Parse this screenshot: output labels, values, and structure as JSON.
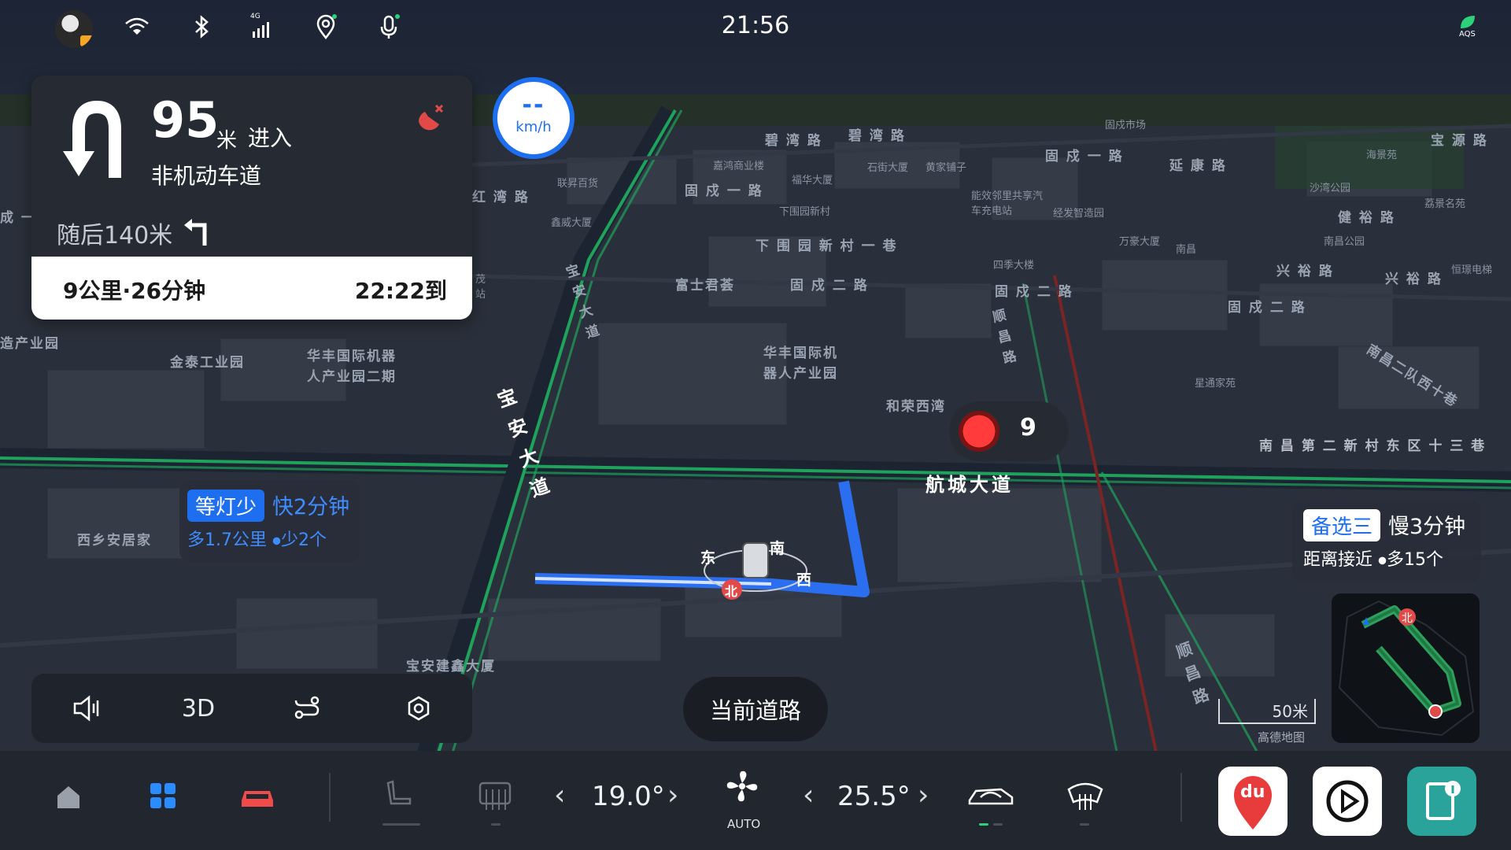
{
  "status_bar": {
    "time": "21:56",
    "icons": [
      "avatar",
      "wifi-icon",
      "bluetooth-icon",
      "signal-4g-icon",
      "location-icon",
      "microphone-icon",
      "aqs-icon"
    ],
    "signal_label": "4G",
    "aqs_label": "AQS"
  },
  "navigation": {
    "distance": "95",
    "distance_unit": "米",
    "action": "进入",
    "road": "非机动车道",
    "then": "随后140米",
    "trip": "9公里·26分钟",
    "arrival": "22:22到",
    "mute_icon": "mute-broadcast-icon"
  },
  "speed": {
    "value": "--",
    "unit": "km/h"
  },
  "traffic_light": {
    "countdown": "9",
    "color": "#ff3b3b"
  },
  "route_alternatives": [
    {
      "badge": "等灯少",
      "title": "快2分钟",
      "subtitle": "多1.7公里  ⦁少2个",
      "badge_color": "#1e6ff0"
    },
    {
      "badge": "备选三",
      "title": "慢3分钟",
      "subtitle": "距离接近  ⦁多15个",
      "badge_color": "#ffffff"
    }
  ],
  "map": {
    "compass": {
      "east": "东",
      "south": "南",
      "west": "西",
      "north": "北"
    },
    "labels": {
      "bi_wan_1": "碧 湾 路",
      "bi_wan_2": "碧 湾 路",
      "gu_xu_market": "固戍市场",
      "bao_yuan": "宝 源 路",
      "gucheng_1a": "固 戍 一 路",
      "gucheng_1b": "固 戍 一 路",
      "yan_kang": "延 康 路",
      "hai_jing_yuan": "海景苑",
      "jia_hong": "嘉鸿商业楼",
      "fu_cheng": "福华大厦",
      "shi_hua": "石街大厦",
      "huang_jia": "黄家铺子",
      "sha_wan_park": "沙湾公园",
      "jian_yu": "健 裕 路",
      "li_jing": "荔景名苑",
      "lian_jie": "联昇百货",
      "hong_wan": "红 湾 路",
      "xia_wei_xin": "下围园新村",
      "jing_xiang": "能效邻里共享汽车充电站",
      "jing_fa": "经发智造园",
      "nan_chang_park": "南昌公园",
      "xin_wei": "鑫威大厦",
      "wan_hao": "万豪大厦",
      "nan_chang_a": "南昌",
      "xing_yu_1": "兴 裕 路",
      "xing_yu_2": "兴 裕 路",
      "heng_tai": "恒璟电梯",
      "xia_wei_1": "下 围 园 新 村 一 巷",
      "si_ji": "四季大楼",
      "fu_shi": "富士君荟",
      "gucheng_2a": "固 戍 二 路",
      "gucheng_2b": "固 戍 二 路",
      "gucheng_2c": "固 戍 二 路",
      "nan_chang_2": "南昌二队西十巷",
      "bao_an_1": "宝 安 大 道",
      "bao_an_2": "宝 安 大 道",
      "jin_tai": "金泰工业园",
      "huafeng_1": "华丰国际机器人产业园二期",
      "huafeng_2": "华丰国际机器人产业园",
      "xing_yu_mansion": "星通家苑",
      "he_rong": "和荣西湾",
      "nan_chang_13": "南 昌 第 二 新 村 东 区 十 三 巷",
      "hang_cheng": "航城大道",
      "xi_xiang": "西乡安居家",
      "bao_an_jian": "宝安建鑫大厦",
      "shun_chang": "顺 昌 路",
      "shun_chang_2": "顺 昌 路",
      "left_industry": "造产业园",
      "left_cheng": "成 一",
      "mao_station": "茂站"
    }
  },
  "map_controls": {
    "volume_icon": "volume-icon",
    "mode": "3D",
    "route_icon": "route-preview-icon",
    "settings_icon": "settings-icon"
  },
  "current_road_button": "当前道路",
  "scale": {
    "label": "50米",
    "source": "高德地图"
  },
  "dock": {
    "apps": [
      "home-icon",
      "apps-grid-icon",
      "car-icon"
    ],
    "seat_icon": "seat-heat-icon",
    "rear_defrost_icon": "rear-defrost-icon",
    "driver_temp": "19.0°",
    "fan_label": "AUTO",
    "passenger_temp": "25.5°",
    "recirculation_icon": "air-recirculation-icon",
    "front_defrost_icon": "front-defrost-icon",
    "app_tiles": [
      {
        "name": "baidu-maps-app",
        "label": "du"
      },
      {
        "name": "carplay-app",
        "label": ""
      },
      {
        "name": "manual-app",
        "label": ""
      }
    ]
  }
}
